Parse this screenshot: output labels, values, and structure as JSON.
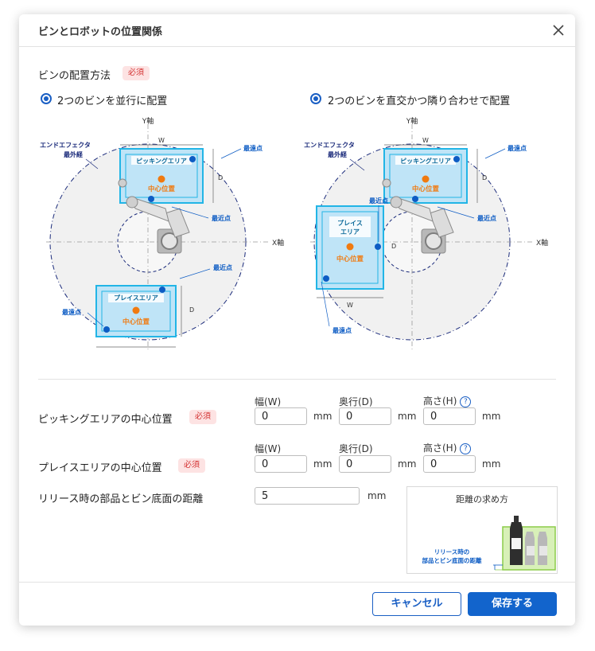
{
  "dialog": {
    "title": "ビンとロボットの位置関係",
    "close_icon": "close-icon"
  },
  "placement": {
    "label": "ビンの配置方法",
    "required": "必須",
    "option_parallel": "2つのビンを並行に配置",
    "option_orthogonal": "2つのビンを直交かつ隣り合わせで配置",
    "selected_parallel": true,
    "selected_orthogonal": true
  },
  "diagram": {
    "y_axis": "Y軸",
    "x_axis": "X軸",
    "w": "W",
    "d": "D",
    "end_effector_line1": "エンドエフェクタ",
    "end_effector_line2": "最外経",
    "farthest": "最遠点",
    "nearest": "最近点",
    "picking_area": "ピッキングエリア",
    "place_area": "プレイスエリア",
    "place_area_line1": "プレイス",
    "place_area_line2": "エリア",
    "center": "中心位置"
  },
  "columns": {
    "width": "幅(W)",
    "depth": "奥行(D)",
    "height": "高さ(H)"
  },
  "picking": {
    "label": "ピッキングエリアの中心位置",
    "required": "必須",
    "w": "0",
    "d": "0",
    "h": "0"
  },
  "place": {
    "label": "プレイスエリアの中心位置",
    "required": "必須",
    "w": "0",
    "d": "0",
    "h": "0"
  },
  "release": {
    "label": "リリース時の部品とビン底面の距離",
    "value": "5",
    "unit": "mm"
  },
  "unit": "mm",
  "how_to": {
    "title": "距離の求め方",
    "caption_line1": "リリース時の",
    "caption_line2": "部品とビン底面の距離"
  },
  "buttons": {
    "cancel": "キャンセル",
    "save": "保存する"
  },
  "colors": {
    "accent": "#1264cc",
    "area_fill": "#bfe4f7",
    "area_border": "#22b5e6",
    "center_dot": "#f07a10",
    "required_bg": "#fde3e3",
    "required_text": "#d43333"
  }
}
